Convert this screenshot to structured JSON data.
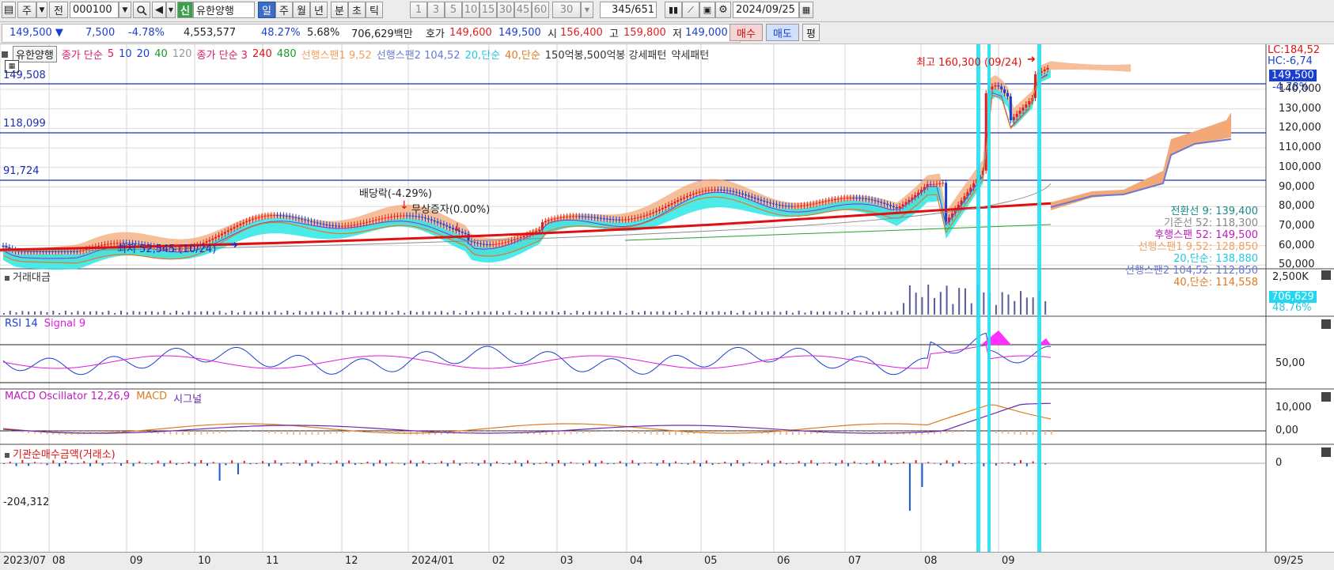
{
  "toolbar": {
    "period_unit": "주",
    "prev_label": "전",
    "code": "000100",
    "credit_badge": "신",
    "stock_name": "유한양행",
    "periods": [
      "일",
      "주",
      "월",
      "년",
      "분",
      "초",
      "틱"
    ],
    "selected_period": "일",
    "intervals": [
      "1",
      "3",
      "5",
      "10",
      "15",
      "30",
      "45",
      "60"
    ],
    "interval_value": "30",
    "count_current": "345",
    "count_total": "/651",
    "date": "2024/09/25"
  },
  "quote": {
    "price": "149,500",
    "change_arrow": "▼",
    "change": "7,500",
    "change_pct": "-4.78%",
    "volume": "4,553,577",
    "volume_ratio": "48.27%",
    "turnover": "5.68%",
    "amount": "706,629백만",
    "bid_label": "호가",
    "bid1": "149,600",
    "bid2": "149,500",
    "open_label": "시",
    "open": "156,400",
    "high_label": "고",
    "high": "159,800",
    "low_label": "저",
    "low": "149,000",
    "buy_label": "매수",
    "sell_label": "매도",
    "eval_label": "평"
  },
  "legend": {
    "name": "유한양행",
    "ma_label": "종가 단순",
    "ma5": "5",
    "ma10": "10",
    "ma20": "20",
    "ma40": "40",
    "ma120": "120",
    "ma2_label": "종가 단순 3",
    "ma240": "240",
    "ma480": "480",
    "span1": "선행스팬1 9,52",
    "span2": "선행스팬2 104,52",
    "ma20s": "20,단순",
    "ma40s": "40,단순",
    "pattern": "150억봉,500억봉 강세패턴",
    "pattern2": "약세패턴"
  },
  "price_pane": {
    "lc": "LC:184,52",
    "hc": "HC:-6,74",
    "current_tag": "149,500",
    "current_pct": "-4.78%",
    "level1": "149,508",
    "level2": "118,099",
    "level3": "91,724",
    "high_note": "최고 160,300 (09/24)",
    "low_note": "최저 52,545 (10/24)",
    "dividend_note": "배당락(-4.29%)",
    "bonus_note": "무상증자(0.00%)",
    "y_ticks": [
      "140,000",
      "130,000",
      "120,000",
      "110,000",
      "100,000",
      "90,000",
      "80,000",
      "70,000",
      "60,000",
      "50,000"
    ],
    "ichimoku": {
      "tenkan": "전환선 9: 139,400",
      "kijun": "기준선 52: 118,300",
      "chikou": "후행스팬 52: 149,500",
      "senkou1": "선행스팬1 9,52: 128,850",
      "ma20": "20,단순: 138,880",
      "senkou2": "선행스팬2 104,52: 112,850",
      "ma40": "40,단순: 114,558"
    }
  },
  "volume_pane": {
    "title": "거래대금",
    "tick": "2,500K",
    "current_tag": "706,629",
    "current_pct": "48.76%"
  },
  "rsi_pane": {
    "title": "RSI 14",
    "signal": "Signal 9",
    "tick": "50,00"
  },
  "macd_pane": {
    "title": "MACD Oscillator 12,26,9",
    "macd": "MACD",
    "signal": "시그널",
    "tick1": "10,000",
    "tick2": "0,00"
  },
  "inst_pane": {
    "title": "기관순매수금액(거래소)",
    "tick": "0",
    "min_label": "-204,312"
  },
  "xaxis": {
    "labels": [
      "2023/07",
      "08",
      "09",
      "10",
      "11",
      "12",
      "2024/01",
      "02",
      "03",
      "04",
      "05",
      "06",
      "07",
      "08",
      "09"
    ],
    "last": "09/25"
  },
  "colors": {
    "toolbar_bg": "#ececec",
    "selected": "#3b6cc9",
    "up": "#e02020",
    "down": "#1a3fd0",
    "cloud_up": "#2ee6e6",
    "cloud_down": "#f0a060",
    "ma_red": "#e01010",
    "highlight": "#22e0f0",
    "rsi_fill": "#ff30ff"
  }
}
